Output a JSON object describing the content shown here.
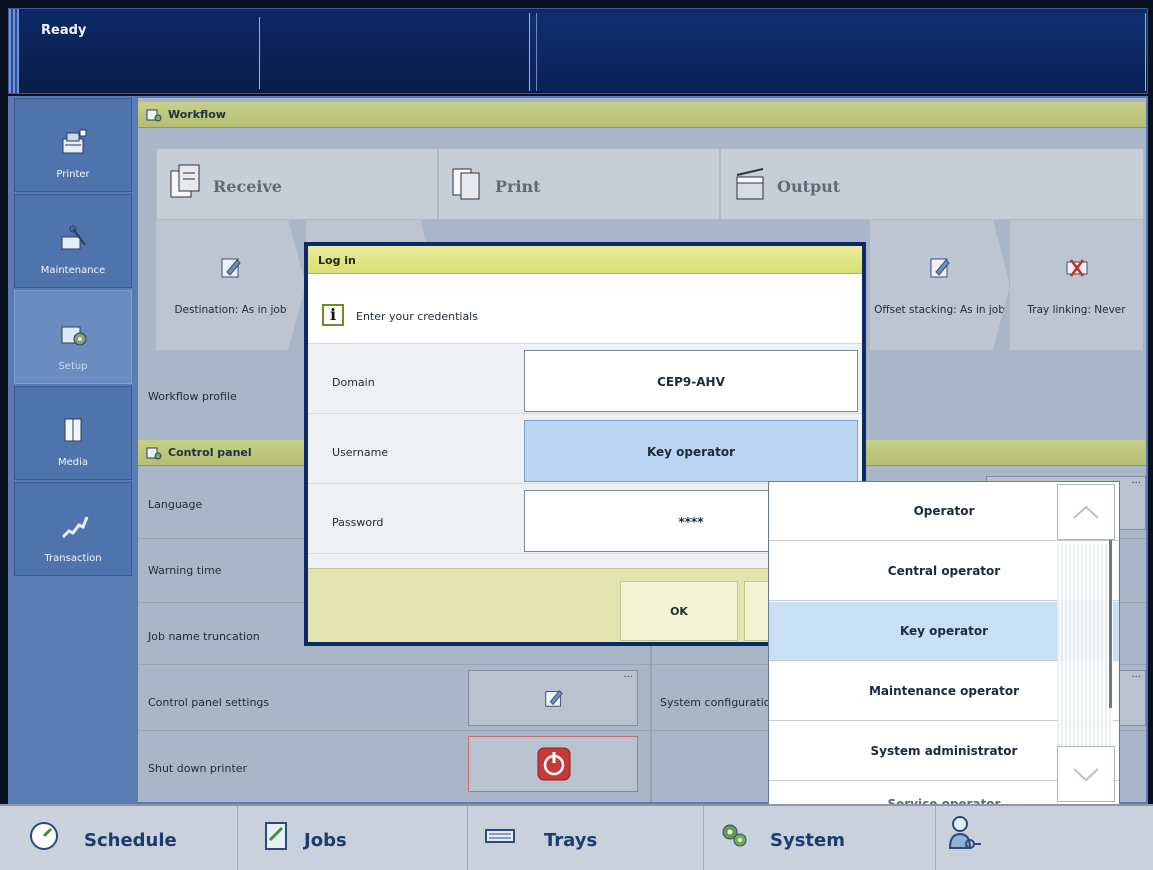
{
  "status": {
    "text": "Ready"
  },
  "sidebar": {
    "items": [
      {
        "label": "Printer",
        "icon": "printer-icon",
        "active": false
      },
      {
        "label": "Maintenance",
        "icon": "maintenance-icon",
        "active": false
      },
      {
        "label": "Setup",
        "icon": "setup-icon",
        "active": true
      },
      {
        "label": "Media",
        "icon": "media-icon",
        "active": false
      },
      {
        "label": "Transaction",
        "icon": "transaction-icon",
        "active": false
      }
    ]
  },
  "workflow": {
    "title": "Workflow",
    "stages": [
      {
        "label": "Receive",
        "icon": "receive-icon"
      },
      {
        "label": "Print",
        "icon": "print-icon"
      },
      {
        "label": "Output",
        "icon": "output-icon"
      }
    ],
    "tiles": [
      {
        "label": "Destination: As in job",
        "icon": "edit-icon"
      },
      {
        "label": "Offset stacking: As in job",
        "icon": "edit-icon"
      },
      {
        "label": "Tray linking: Never",
        "icon": "tray-linking-disabled-icon"
      }
    ],
    "profile_label": "Workflow profile"
  },
  "control_panel": {
    "title": "Control panel",
    "rows": [
      {
        "label": "Language"
      },
      {
        "label": "Warning time"
      },
      {
        "label": "Job name truncation"
      },
      {
        "label": "Control panel settings"
      },
      {
        "label": "Shut down printer"
      }
    ],
    "right_rows": [
      {
        "label": "System configuration"
      }
    ],
    "more": "..."
  },
  "login_dialog": {
    "title": "Log in",
    "message": "Enter your credentials",
    "info_glyph": "i",
    "fields": [
      {
        "label": "Domain",
        "value": "CEP9-AHV"
      },
      {
        "label": "Username",
        "value": "Key operator"
      },
      {
        "label": "Password",
        "value": "****"
      }
    ],
    "ok_label": "OK"
  },
  "role_dropdown": {
    "options": [
      "Operator",
      "Central operator",
      "Key operator",
      "Maintenance operator",
      "System administrator",
      "Service operator"
    ],
    "selected": "Key operator"
  },
  "bottom_nav": {
    "items": [
      {
        "label": "Schedule",
        "icon": "schedule-icon"
      },
      {
        "label": "Jobs",
        "icon": "jobs-icon"
      },
      {
        "label": "Trays",
        "icon": "trays-icon"
      },
      {
        "label": "System",
        "icon": "system-icon"
      },
      {
        "label": "",
        "icon": "user-login-icon"
      }
    ]
  },
  "colors": {
    "header_yellow": "#d9df73",
    "selection_blue": "#bad5f2",
    "nav_blue": "#4f74ad",
    "dark_navy": "#0d2a66"
  }
}
